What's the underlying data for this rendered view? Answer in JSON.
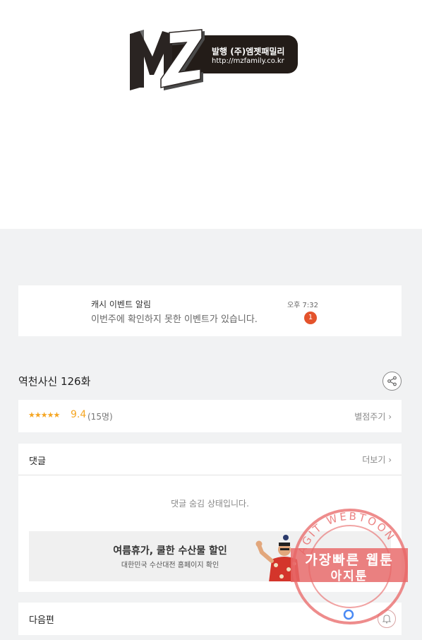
{
  "publisher": {
    "logo_text": "MZ",
    "line1": "발행 (주)엠젯패밀리",
    "line2": "http://mzfamily.co.kr"
  },
  "notification": {
    "title": "캐시 이벤트 알림",
    "message": "이번주에 확인하지 못한 이벤트가 있습니다.",
    "time": "오후 7:32",
    "count": "1"
  },
  "episode": {
    "title": "역천사신 126화",
    "share_icon": "share-icon"
  },
  "rating": {
    "stars": "★★★★★",
    "score": "9.4",
    "count": "(15명)",
    "rate_link": "별점주기 ›"
  },
  "comments": {
    "title": "댓글",
    "more_link": "더보기 ›",
    "hidden_message": "댓글 숨김 상태입니다."
  },
  "ad": {
    "title": "여름휴가, 쿨한 수산물 할인",
    "subtitle": "대한민국 수산대전 홈페이지 확인"
  },
  "next": {
    "title": "다음편",
    "bell_icon": "bell-icon"
  },
  "watermark": {
    "ring_text": "AGIT WEBTOON",
    "line1": "가장빠른 웹툰",
    "line2": "아지툰"
  },
  "colors": {
    "accent": "#f5a623",
    "badge": "#e4532c",
    "stamp": "#e86666"
  }
}
